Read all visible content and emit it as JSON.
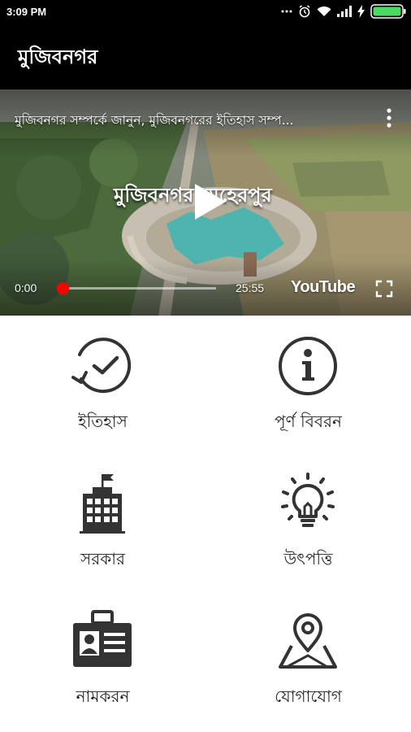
{
  "status_bar": {
    "time": "3:09 PM"
  },
  "app_bar": {
    "title": "মুজিবনগর"
  },
  "video": {
    "title": "মুজিবনগর সম্পর্কে জানুন, মুজিবনগরের ইতিহাস সম্প...",
    "overlay_text": "মুজিবনগর মেহেরপুর",
    "current_time": "0:00",
    "total_time": "25:55",
    "progress": 0,
    "brand": "YouTube"
  },
  "menu": {
    "items": [
      {
        "label": "ইতিহাস",
        "icon": "history-clock-icon"
      },
      {
        "label": "পূর্ণ বিবরন",
        "icon": "info-icon"
      },
      {
        "label": "সরকার",
        "icon": "government-building-icon"
      },
      {
        "label": "উৎপত্তি",
        "icon": "lightbulb-icon"
      },
      {
        "label": "নামকরন",
        "icon": "id-card-icon"
      },
      {
        "label": "যোগাযোগ",
        "icon": "map-pin-icon"
      }
    ]
  },
  "colors": {
    "accent": "#ff0000",
    "icon": "#333333",
    "bar": "#000000"
  }
}
